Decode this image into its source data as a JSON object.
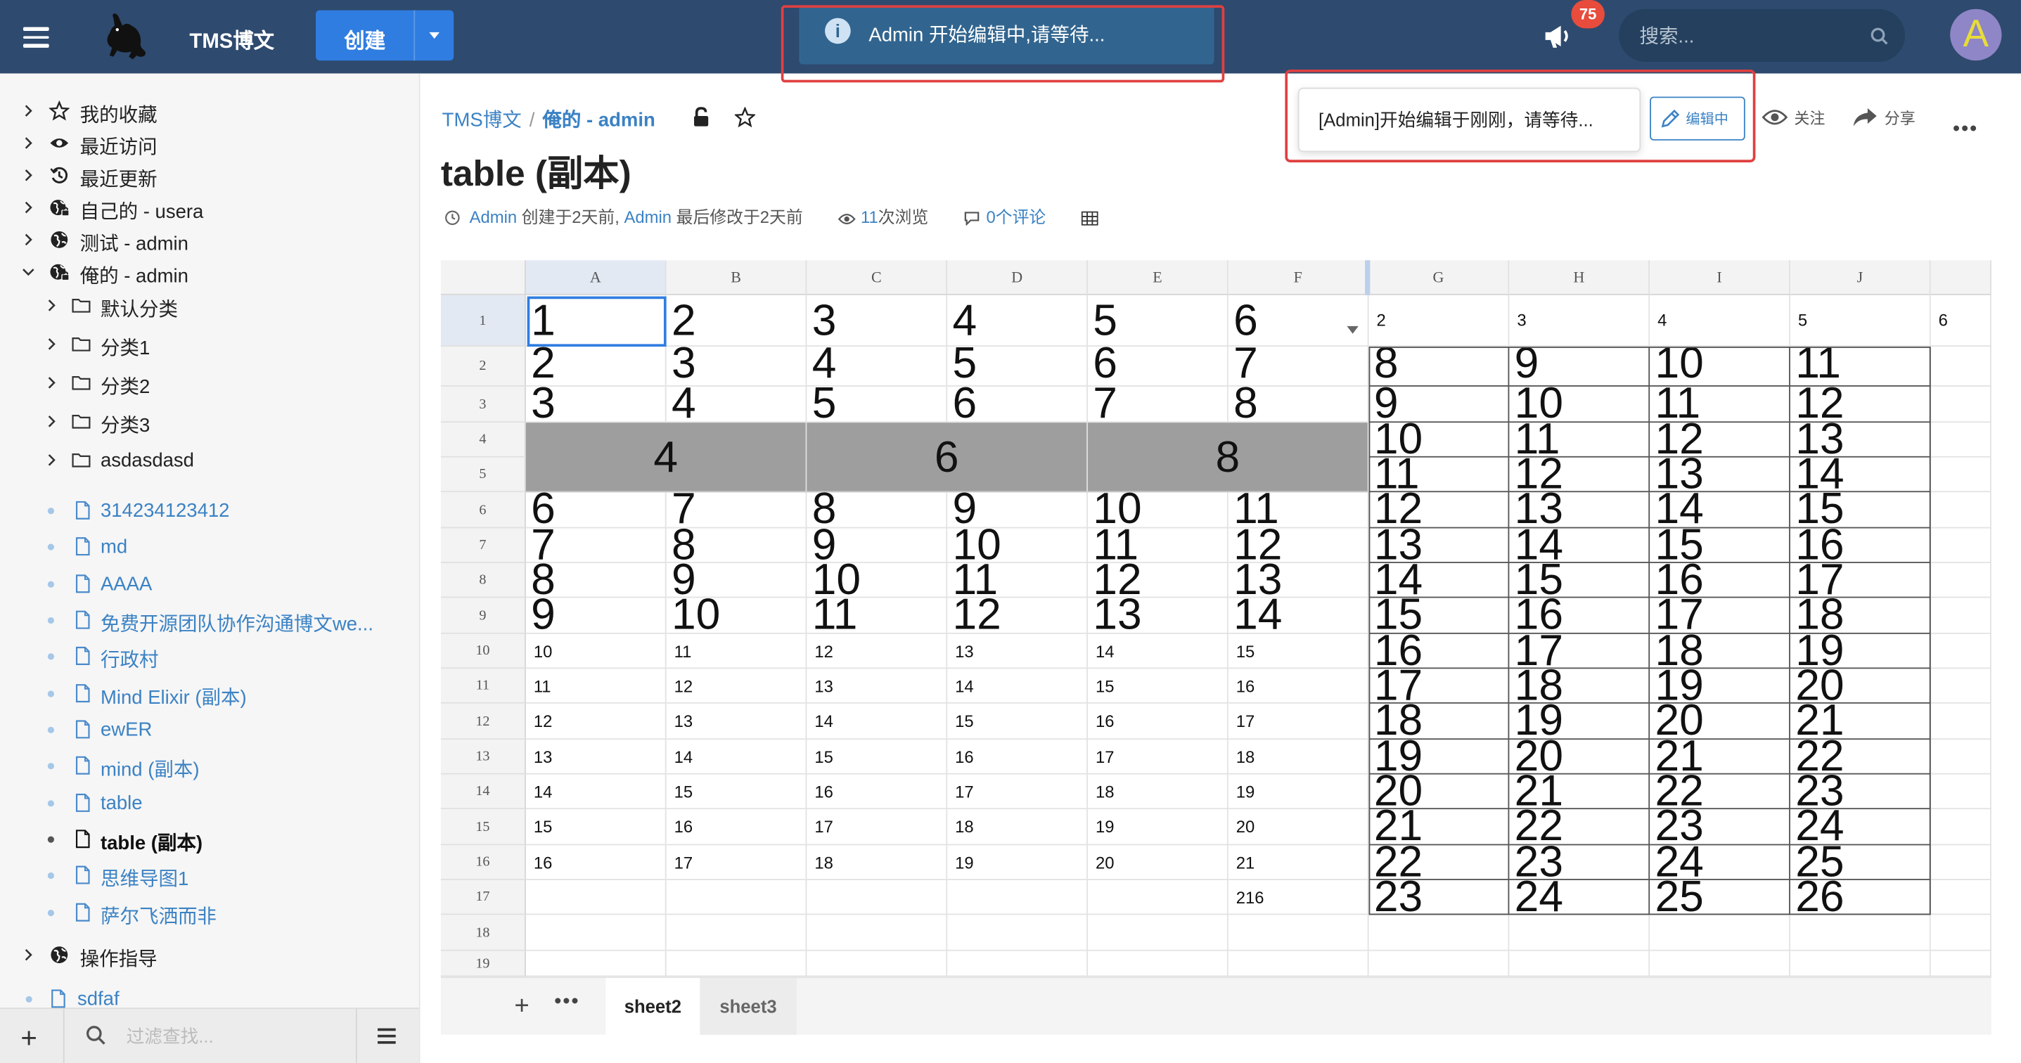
{
  "topbar": {
    "brand": "TMS博文",
    "create_label": "创建",
    "toast": "Admin 开始编辑中,请等待...",
    "notify_count": "75",
    "search_placeholder": "搜索...",
    "avatar_letter": "A"
  },
  "sidebar": {
    "groups": [
      {
        "label": "我的收藏",
        "icon": "star-icon"
      },
      {
        "label": "最近访问",
        "icon": "eye-icon"
      },
      {
        "label": "最近更新",
        "icon": "history-icon"
      },
      {
        "label": "自己的 - usera",
        "icon": "globe-lock-icon"
      },
      {
        "label": "测试 - admin",
        "icon": "globe-icon"
      },
      {
        "label": "俺的 - admin",
        "icon": "globe-lock-icon"
      }
    ],
    "folders": [
      "默认分类",
      "分类1",
      "分类2",
      "分类3",
      "asdasdasd"
    ],
    "docs": [
      "314234123412",
      "md",
      "AAAA",
      "免费开源团队协作沟通博文we...",
      "行政村",
      "Mind Elixir (副本)",
      "ewER",
      "mind (副本)",
      "table",
      "table (副本)",
      "思维导图1",
      "萨尔飞洒而非"
    ],
    "guide": "操作指导",
    "last_doc": "sdfaf",
    "filter_placeholder": "过滤查找..."
  },
  "header": {
    "crumb_root": "TMS博文",
    "crumb_space": "俺的 - admin",
    "title": "table (副本)",
    "meta_creator": "Admin",
    "meta_created": "创建于2天前,",
    "meta_modifier": "Admin",
    "meta_modified": "最后修改于2天前",
    "views_count": "11",
    "views_label": "次浏览",
    "comments": "0个评论",
    "edit_popup": "[Admin]开始编辑于刚刚，请等待...",
    "edit_status": "编辑中",
    "watch": "关注",
    "share": "分享"
  },
  "spreadsheet": {
    "columns": [
      "A",
      "B",
      "C",
      "D",
      "E",
      "F",
      "G",
      "H",
      "I",
      "J"
    ],
    "rows": [
      "1",
      "2",
      "3",
      "4",
      "5",
      "6",
      "7",
      "8",
      "9",
      "10",
      "11",
      "12",
      "13",
      "14",
      "15",
      "16",
      "17",
      "18",
      "19"
    ],
    "row1_af": [
      "1",
      "2",
      "3",
      "4",
      "5",
      "6"
    ],
    "row1_gk": [
      "2",
      "3",
      "4",
      "5",
      "6"
    ],
    "rows23_af": [
      [
        "2",
        "3",
        "4",
        "5",
        "6",
        "7"
      ],
      [
        "3",
        "4",
        "5",
        "6",
        "7",
        "8"
      ]
    ],
    "merged_45": [
      "4",
      "6",
      "8"
    ],
    "rows69_af": [
      [
        "6",
        "7",
        "8",
        "9",
        "10",
        "11"
      ],
      [
        "7",
        "8",
        "9",
        "10",
        "11",
        "12"
      ],
      [
        "8",
        "9",
        "10",
        "11",
        "12",
        "13"
      ],
      [
        "9",
        "10",
        "11",
        "12",
        "13",
        "14"
      ]
    ],
    "rows1016_af": [
      [
        "10",
        "11",
        "12",
        "13",
        "14",
        "15"
      ],
      [
        "11",
        "12",
        "13",
        "14",
        "15",
        "16"
      ],
      [
        "12",
        "13",
        "14",
        "15",
        "16",
        "17"
      ],
      [
        "13",
        "14",
        "15",
        "16",
        "17",
        "18"
      ],
      [
        "14",
        "15",
        "16",
        "17",
        "18",
        "19"
      ],
      [
        "15",
        "16",
        "17",
        "18",
        "19",
        "20"
      ],
      [
        "16",
        "17",
        "18",
        "19",
        "20",
        "21"
      ]
    ],
    "f17": "216",
    "gj_rows": [
      [
        "8",
        "9",
        "10",
        "11"
      ],
      [
        "9",
        "10",
        "11",
        "12"
      ],
      [
        "10",
        "11",
        "12",
        "13"
      ],
      [
        "11",
        "12",
        "13",
        "14"
      ],
      [
        "12",
        "13",
        "14",
        "15"
      ],
      [
        "13",
        "14",
        "15",
        "16"
      ],
      [
        "14",
        "15",
        "16",
        "17"
      ],
      [
        "15",
        "16",
        "17",
        "18"
      ],
      [
        "16",
        "17",
        "18",
        "19"
      ],
      [
        "17",
        "18",
        "19",
        "20"
      ],
      [
        "18",
        "19",
        "20",
        "21"
      ],
      [
        "19",
        "20",
        "21",
        "22"
      ],
      [
        "20",
        "21",
        "22",
        "23"
      ],
      [
        "21",
        "22",
        "23",
        "24"
      ],
      [
        "22",
        "23",
        "24",
        "25"
      ],
      [
        "23",
        "24",
        "25",
        "26"
      ]
    ],
    "tabs": [
      "sheet2",
      "sheet3"
    ]
  }
}
